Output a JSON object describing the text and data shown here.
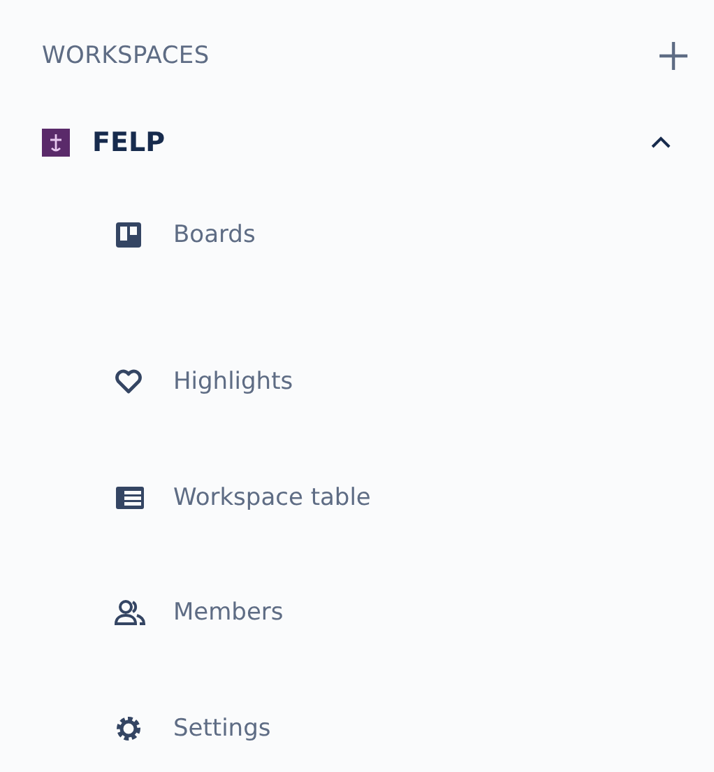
{
  "header": {
    "title": "WORKSPACES"
  },
  "workspace": {
    "name": "FELP",
    "expanded": true,
    "items": [
      {
        "kind": "boards",
        "label": "Boards"
      },
      {
        "kind": "highlights",
        "label": "Highlights"
      },
      {
        "kind": "table",
        "label": "Workspace table"
      },
      {
        "kind": "members",
        "label": "Members"
      },
      {
        "kind": "settings",
        "label": "Settings"
      }
    ]
  }
}
